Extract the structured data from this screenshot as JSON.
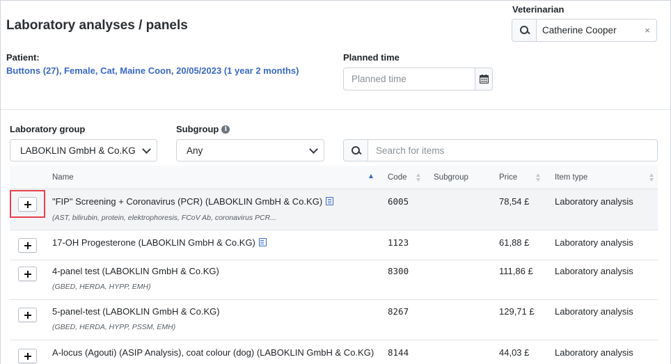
{
  "header": {
    "title": "Laboratory analyses / panels"
  },
  "veterinarian": {
    "label": "Veterinarian",
    "value": "Catherine Cooper",
    "icon": "search-icon",
    "clear_icon": "×"
  },
  "patient": {
    "label": "Patient:",
    "value": "Buttons (27), Female, Cat, Maine Coon, 20/05/2023 (1 year 2 months)"
  },
  "planned_time": {
    "label": "Planned time",
    "placeholder": "Planned time",
    "icon": "calendar-icon"
  },
  "filters": {
    "laboratory_group": {
      "label": "Laboratory group",
      "selected": "LABOKLIN GmbH & Co.KG"
    },
    "subgroup": {
      "label": "Subgroup",
      "info_icon": "i",
      "selected": "Any"
    },
    "search": {
      "placeholder": "Search for items"
    }
  },
  "table": {
    "columns": {
      "name": "Name",
      "code": "Code",
      "subgroup": "Subgroup",
      "price": "Price",
      "item_type": "Item type"
    },
    "sort": {
      "column": "name",
      "direction": "ascending"
    },
    "rows": [
      {
        "name": "\"FIP\" Screening + Coronavirus (PCR) (LABOKLIN GmbH & Co.KG)",
        "details": "(AST, bilirubin, protein, elektrophoresis, FCoV Ab, coronavirus PCR...",
        "code": "6005",
        "subgroup": "",
        "price": "78,54 £",
        "item_type": "Laboratory analysis",
        "has_doc_icon": true,
        "highlighted": true
      },
      {
        "name": "17-OH Progesterone (LABOKLIN GmbH & Co.KG)",
        "details": "",
        "code": "1123",
        "subgroup": "",
        "price": "61,88 £",
        "item_type": "Laboratory analysis",
        "has_doc_icon": true,
        "highlighted": false
      },
      {
        "name": "4-panel test (LABOKLIN GmbH & Co.KG)",
        "details": "(GBED, HERDA, HYPP, EMH)",
        "code": "8300",
        "subgroup": "",
        "price": "111,86 £",
        "item_type": "Laboratory analysis",
        "has_doc_icon": false,
        "highlighted": false
      },
      {
        "name": "5-panel-test (LABOKLIN GmbH & Co.KG)",
        "details": "(GBED, HERDA, HYPP, PSSM, EMH)",
        "code": "8267",
        "subgroup": "",
        "price": "129,71 £",
        "item_type": "Laboratory analysis",
        "has_doc_icon": false,
        "highlighted": false
      },
      {
        "name": "A-locus (Agouti) (ASIP Analysis), coat colour (dog) (LABOKLIN GmbH & Co.KG)",
        "details": "",
        "code": "8144",
        "subgroup": "",
        "price": "44,03 £",
        "item_type": "Laboratory analysis",
        "has_doc_icon": false,
        "highlighted": false
      }
    ]
  },
  "colors": {
    "link_blue": "#3a68c4",
    "focus_red": "#e8404a",
    "row_highlight": "#f3f4f6"
  }
}
